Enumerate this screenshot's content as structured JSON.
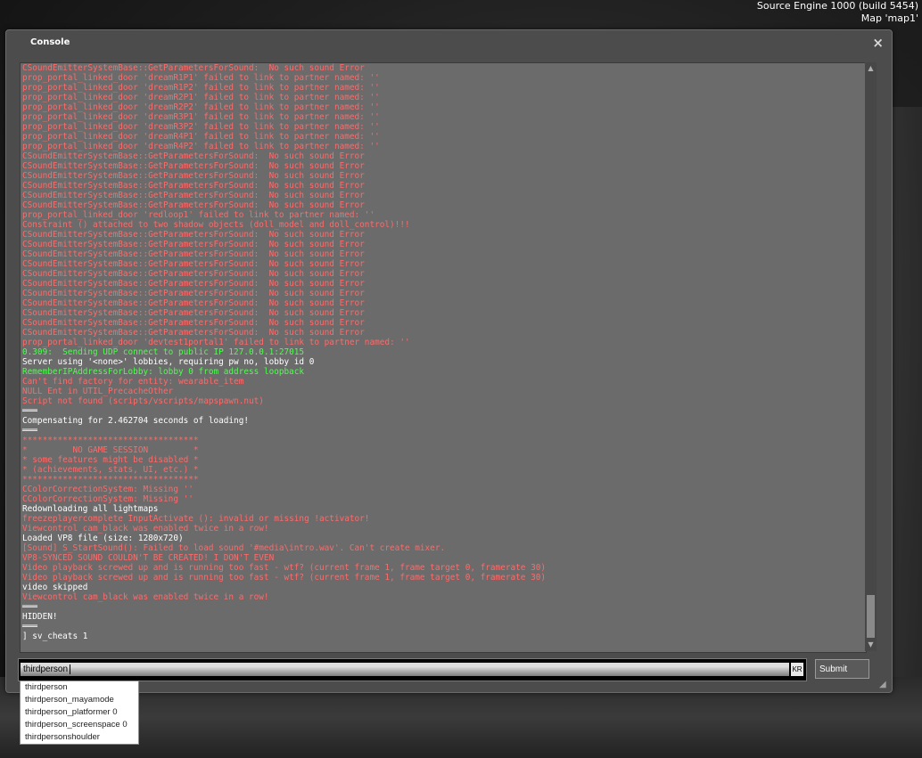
{
  "engine": {
    "line1": "Source Engine 1000 (build 5454)",
    "line2": "Map 'map1'"
  },
  "console": {
    "title": "Console",
    "close_icon": "×",
    "scroll_up_icon": "▲",
    "scroll_down_icon": "▼",
    "grip_icon": "◢",
    "log_lines": [
      {
        "text": "CSoundEmitterSystemBase::GetParametersForSound:  No such sound Error",
        "color": "red"
      },
      {
        "text": "prop_portal_linked_door 'dreamR1P1' failed to link to partner named: ''",
        "color": "red"
      },
      {
        "text": "prop_portal_linked_door 'dreamR1P2' failed to link to partner named: ''",
        "color": "red"
      },
      {
        "text": "prop_portal_linked_door 'dreamR2P1' failed to link to partner named: ''",
        "color": "red"
      },
      {
        "text": "prop_portal_linked_door 'dreamR2P2' failed to link to partner named: ''",
        "color": "red"
      },
      {
        "text": "prop_portal_linked_door 'dreamR3P1' failed to link to partner named: ''",
        "color": "red"
      },
      {
        "text": "prop_portal_linked_door 'dreamR3P2' failed to link to partner named: ''",
        "color": "red"
      },
      {
        "text": "prop_portal_linked_door 'dreamR4P1' failed to link to partner named: ''",
        "color": "red"
      },
      {
        "text": "prop_portal_linked_door 'dreamR4P2' failed to link to partner named: ''",
        "color": "red"
      },
      {
        "text": "CSoundEmitterSystemBase::GetParametersForSound:  No such sound Error",
        "color": "red"
      },
      {
        "text": "CSoundEmitterSystemBase::GetParametersForSound:  No such sound Error",
        "color": "red"
      },
      {
        "text": "CSoundEmitterSystemBase::GetParametersForSound:  No such sound Error",
        "color": "red"
      },
      {
        "text": "CSoundEmitterSystemBase::GetParametersForSound:  No such sound Error",
        "color": "red"
      },
      {
        "text": "CSoundEmitterSystemBase::GetParametersForSound:  No such sound Error",
        "color": "red"
      },
      {
        "text": "CSoundEmitterSystemBase::GetParametersForSound:  No such sound Error",
        "color": "red"
      },
      {
        "text": "prop_portal_linked_door 'redloop1' failed to link to partner named: ''",
        "color": "red"
      },
      {
        "text": "Constraint () attached to two shadow objects (doll_model and doll_control)!!!",
        "color": "red"
      },
      {
        "text": "CSoundEmitterSystemBase::GetParametersForSound:  No such sound Error",
        "color": "red"
      },
      {
        "text": "CSoundEmitterSystemBase::GetParametersForSound:  No such sound Error",
        "color": "red"
      },
      {
        "text": "CSoundEmitterSystemBase::GetParametersForSound:  No such sound Error",
        "color": "red"
      },
      {
        "text": "CSoundEmitterSystemBase::GetParametersForSound:  No such sound Error",
        "color": "red"
      },
      {
        "text": "CSoundEmitterSystemBase::GetParametersForSound:  No such sound Error",
        "color": "red"
      },
      {
        "text": "CSoundEmitterSystemBase::GetParametersForSound:  No such sound Error",
        "color": "red"
      },
      {
        "text": "CSoundEmitterSystemBase::GetParametersForSound:  No such sound Error",
        "color": "red"
      },
      {
        "text": "CSoundEmitterSystemBase::GetParametersForSound:  No such sound Error",
        "color": "red"
      },
      {
        "text": "CSoundEmitterSystemBase::GetParametersForSound:  No such sound Error",
        "color": "red"
      },
      {
        "text": "CSoundEmitterSystemBase::GetParametersForSound:  No such sound Error",
        "color": "red"
      },
      {
        "text": "CSoundEmitterSystemBase::GetParametersForSound:  No such sound Error",
        "color": "red"
      },
      {
        "text": "prop_portal_linked_door 'devtest1portal1' failed to link to partner named: ''",
        "color": "red"
      },
      {
        "text": "0.309:  Sending UDP connect to public IP 127.0.0.1:27015",
        "color": "green"
      },
      {
        "text": "Server using '<none>' lobbies, requiring pw no, lobby id 0",
        "color": "white"
      },
      {
        "text": "RememberIPAddressForLobby: lobby 0 from address loopback",
        "color": "green"
      },
      {
        "text": "Can't find factory for entity: wearable_item",
        "color": "red"
      },
      {
        "text": "NULL Ent in UTIL_PrecacheOther",
        "color": "red"
      },
      {
        "text": "Script not found (scripts/vscripts/mapspawn.nut)",
        "color": "red"
      },
      {
        "text": "═══",
        "color": "white"
      },
      {
        "text": "Compensating for 2.462704 seconds of loading!",
        "color": "white"
      },
      {
        "text": "═══",
        "color": "white"
      },
      {
        "text": "***********************************",
        "color": "red"
      },
      {
        "text": "*         NO GAME SESSION         *",
        "color": "red"
      },
      {
        "text": "* some features might be disabled *",
        "color": "red"
      },
      {
        "text": "* (achievements, stats, UI, etc.) *",
        "color": "red"
      },
      {
        "text": "***********************************",
        "color": "red"
      },
      {
        "text": "CColorCorrectionSystem: Missing ''",
        "color": "red"
      },
      {
        "text": "CColorCorrectionSystem: Missing ''",
        "color": "red"
      },
      {
        "text": "Redownloading all lightmaps",
        "color": "white"
      },
      {
        "text": "freezeplayercomplete InputActivate (): invalid or missing !activator!",
        "color": "red"
      },
      {
        "text": "Viewcontrol cam_black was enabled twice in a row!",
        "color": "red"
      },
      {
        "text": "Loaded VP8 file (size: 1280x720)",
        "color": "white"
      },
      {
        "text": "[Sound] S_StartSound(): Failed to load sound '#media\\intro.wav'. Can't create mixer.",
        "color": "red"
      },
      {
        "text": "VP8-SYNCED SOUND COULDN'T BE CREATED! I DON'T EVEN",
        "color": "red"
      },
      {
        "text": "Video playback screwed up and is running too fast - wtf? (current frame 1, frame target 0, framerate 30)",
        "color": "red"
      },
      {
        "text": "Video playback screwed up and is running too fast - wtf? (current frame 1, frame target 0, framerate 30)",
        "color": "red"
      },
      {
        "text": "video skipped",
        "color": "white"
      },
      {
        "text": "Viewcontrol cam_black was enabled twice in a row!",
        "color": "red"
      },
      {
        "text": "═══",
        "color": "white"
      },
      {
        "text": "HIDDEN!",
        "color": "white"
      },
      {
        "text": "═══",
        "color": "white"
      },
      {
        "text": "] sv_cheats 1",
        "color": "white"
      }
    ],
    "input": {
      "value": "thirdperson",
      "lang_badge": "KR"
    },
    "submit_label": "Submit",
    "autocomplete": [
      "thirdperson",
      "thirdperson_mayamode",
      "thirdperson_platformer 0",
      "thirdperson_screenspace 0",
      "thirdpersonshoulder"
    ]
  }
}
